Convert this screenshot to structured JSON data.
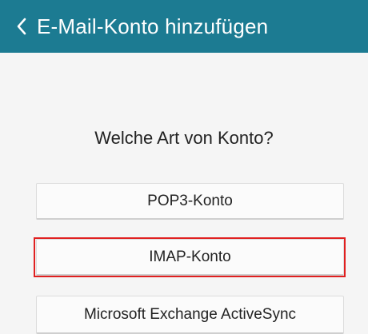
{
  "app_bar": {
    "back_icon": "chevron-left-icon",
    "title": "E-Mail-Konto hinzufügen",
    "color": "#1c7b92"
  },
  "main": {
    "question": "Welche Art von Konto?",
    "options": [
      {
        "label": "POP3-Konto"
      },
      {
        "label": "IMAP-Konto",
        "highlighted": true
      },
      {
        "label": "Microsoft Exchange ActiveSync"
      }
    ],
    "highlight_color": "#e02020"
  }
}
